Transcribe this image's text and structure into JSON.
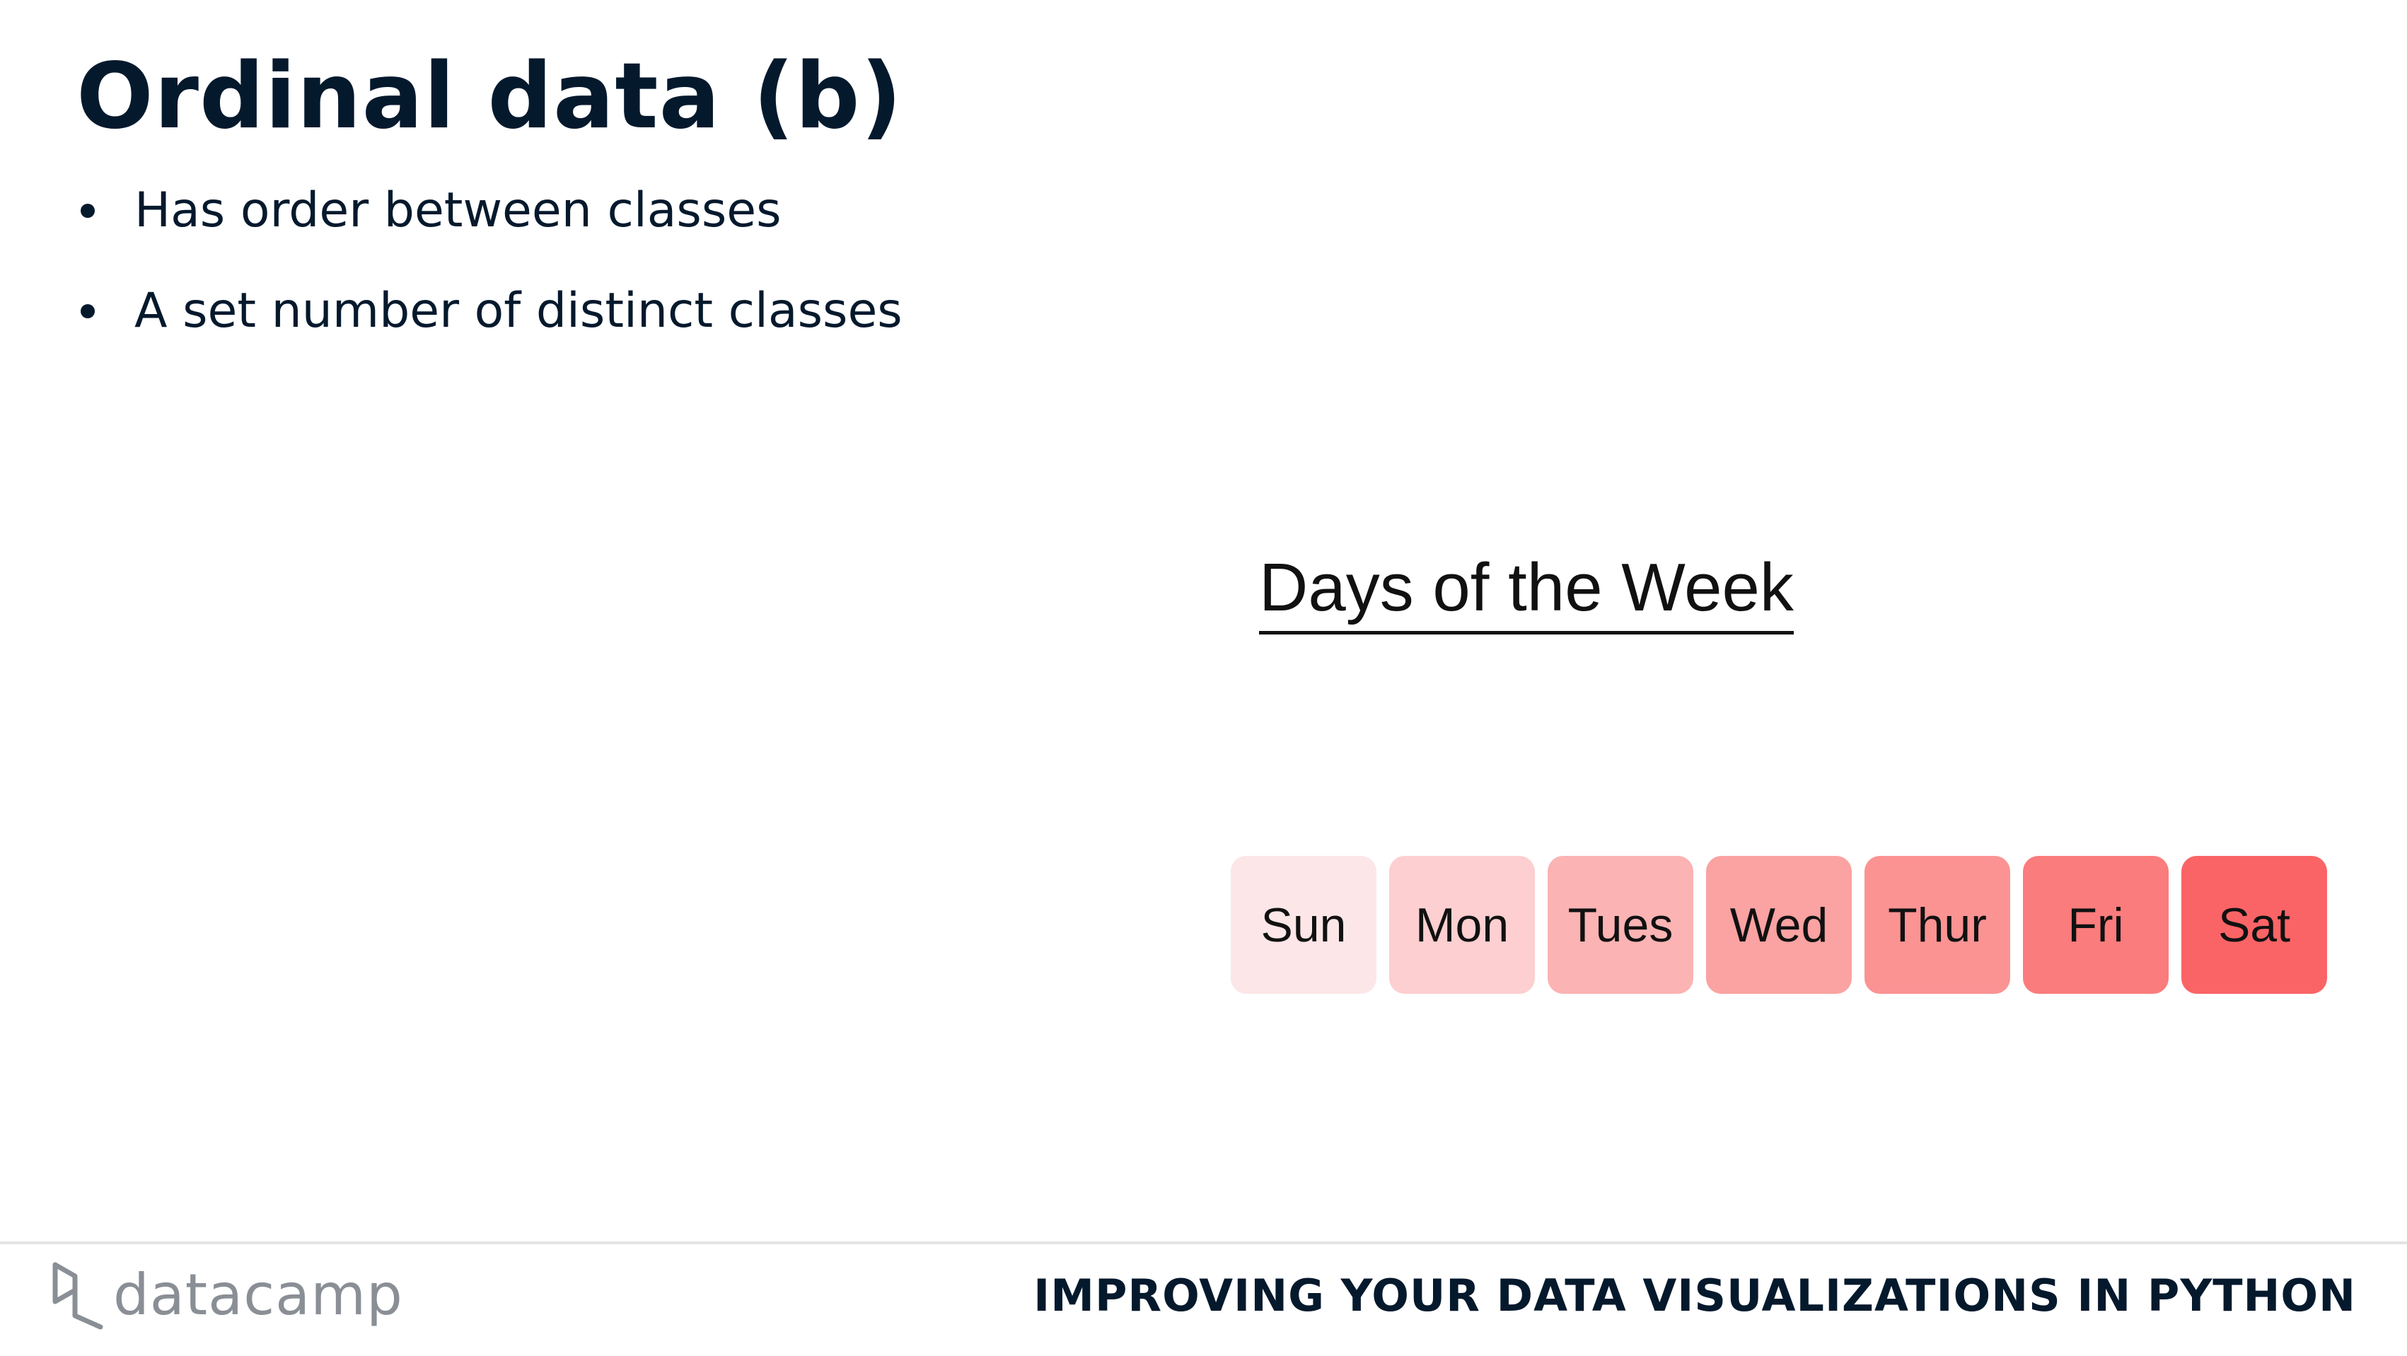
{
  "slide": {
    "title": "Ordinal data (b)",
    "bullets": [
      "Has order between classes",
      "A set number of distinct classes"
    ]
  },
  "figure": {
    "title": "Days of the Week",
    "days": [
      {
        "label": "Sun",
        "color": "#fde6e7"
      },
      {
        "label": "Mon",
        "color": "#fdcfd0"
      },
      {
        "label": "Tues",
        "color": "#fbb3b3"
      },
      {
        "label": "Wed",
        "color": "#fba2a2"
      },
      {
        "label": "Thur",
        "color": "#fb9393"
      },
      {
        "label": "Fri",
        "color": "#fb7c7c"
      },
      {
        "label": "Sat",
        "color": "#fb6466"
      }
    ]
  },
  "footer": {
    "logo_text": "datacamp",
    "logo_icon": "datacamp-logo-icon",
    "course_title": "IMPROVING YOUR DATA VISUALIZATIONS IN PYTHON"
  }
}
